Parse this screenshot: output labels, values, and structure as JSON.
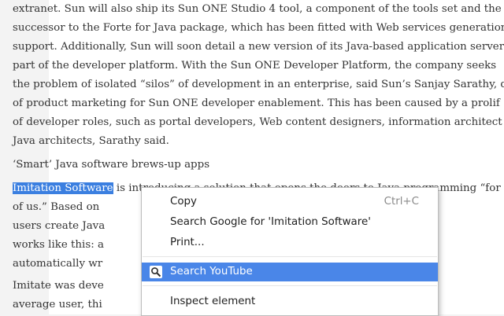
{
  "article": {
    "lines": [
      "extranet. Sun will also ship its Sun ONE Studio 4 tool, a component of the tools set and the",
      "successor to the Forte for Java package, which has been fitted with Web services generation",
      "support. Additionally, Sun will soon detail a new version of its Java-based application server",
      "part of the developer platform. With the Sun ONE Developer Platform, the company seeks",
      "the problem of isolated “silos” of development in an enterprise, said Sun’s Sanjay Sarathy, d",
      "of product marketing for Sun ONE developer enablement. This has been caused by a prolif",
      "of developer roles, such as portal developers, Web content designers, information architect",
      "Java architects, Sarathy said."
    ],
    "heading": "‘Smart’ Java software brews-up apps",
    "selected_text": "Imitation Software",
    "para2": [
      " is introducing a solution that opens the doors to Java programming “for",
      "of us.” Based on                                                                 lution, Imitate",
      "users create Java                                                          knowledge. Imi",
      "works like this: a                                                          d, and the so",
      "automatically wr"
    ],
    "para3": [
      "Imitate was deve                                                         mund Furse. “",
      "average user, thi                                                          viously beyond"
    ]
  },
  "context_menu": {
    "items": [
      {
        "label": "Copy",
        "shortcut": "Ctrl+C"
      },
      {
        "label": "Search Google for 'Imitation Software'"
      },
      {
        "label": "Print..."
      },
      {
        "label": "Search YouTube",
        "icon": "magnifier-icon",
        "highlighted": true
      },
      {
        "label": "Inspect element"
      }
    ]
  },
  "colors": {
    "selection": "#3b7fe0",
    "menu_highlight": "#4a86e8"
  }
}
